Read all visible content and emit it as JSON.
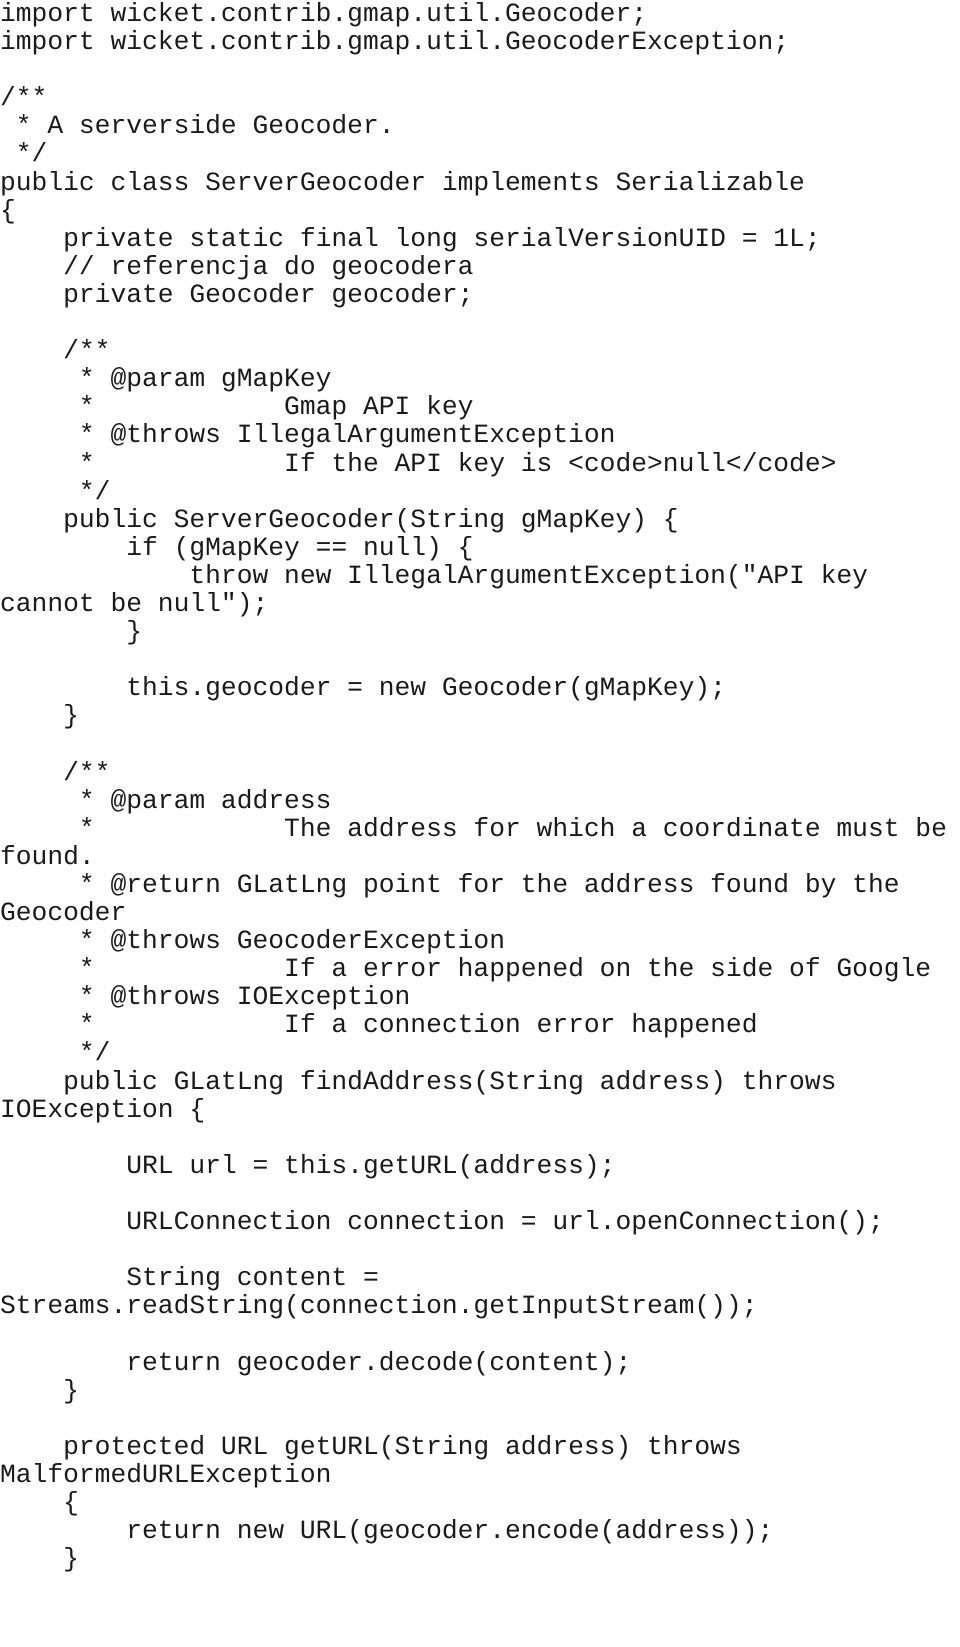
{
  "document": {
    "kind": "source-code-listing",
    "language": "Java",
    "class_name": "ServerGeocoder",
    "text_color": "#1a1a1a",
    "background_color": "#ffffff",
    "lines": [
      "import wicket.contrib.gmap.util.Geocoder;",
      "import wicket.contrib.gmap.util.GeocoderException;",
      "",
      "/**",
      " * A serverside Geocoder.",
      " */",
      "public class ServerGeocoder implements Serializable",
      "{",
      "    private static final long serialVersionUID = 1L;",
      "    // referencja do geocodera",
      "    private Geocoder geocoder;",
      "",
      "    /**",
      "     * @param gMapKey",
      "     *            Gmap API key",
      "     * @throws IllegalArgumentException",
      "     *            If the API key is <code>null</code>",
      "     */",
      "    public ServerGeocoder(String gMapKey) {",
      "        if (gMapKey == null) {",
      "            throw new IllegalArgumentException(\"API key cannot be null\");",
      "        }",
      "",
      "        this.geocoder = new Geocoder(gMapKey);",
      "    }",
      "",
      "    /**",
      "     * @param address",
      "     *            The address for which a coordinate must be found.",
      "     * @return GLatLng point for the address found by the Geocoder",
      "     * @throws GeocoderException",
      "     *            If a error happened on the side of Google",
      "     * @throws IOException",
      "     *            If a connection error happened",
      "     */",
      "    public GLatLng findAddress(String address) throws IOException {",
      "",
      "        URL url = this.getURL(address);",
      "",
      "        URLConnection connection = url.openConnection();",
      "",
      "        String content = Streams.readString(connection.getInputStream());",
      "",
      "        return geocoder.decode(content);",
      "    }",
      "",
      "    protected URL getURL(String address) throws MalformedURLException",
      "    {",
      "        return new URL(geocoder.encode(address));",
      "    }"
    ]
  }
}
